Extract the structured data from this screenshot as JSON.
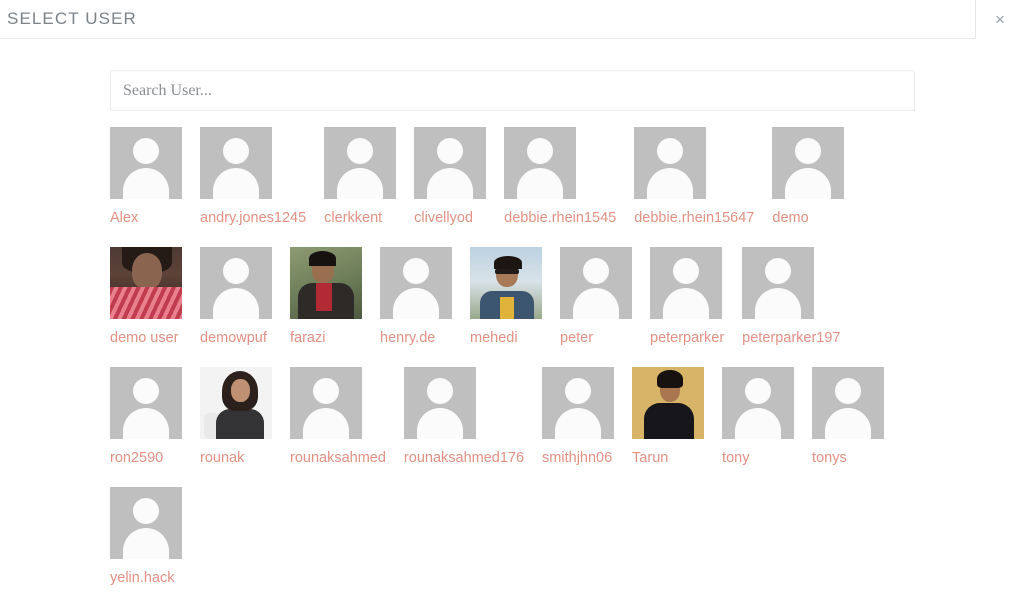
{
  "header": {
    "title": "SELECT USER",
    "close_icon": "close-icon",
    "close_glyph": "×"
  },
  "search": {
    "placeholder": "Search User...",
    "value": ""
  },
  "colors": {
    "label": "#e29184",
    "avatar_placeholder": "#bfbfbf",
    "title": "#7b8288",
    "border": "#e8e8e8"
  },
  "users": [
    {
      "label": "Alex",
      "avatar": "placeholder"
    },
    {
      "label": "andry.jones1245",
      "avatar": "placeholder"
    },
    {
      "label": "clerkkent",
      "avatar": "placeholder"
    },
    {
      "label": "clivellyod",
      "avatar": "placeholder"
    },
    {
      "label": "debbie.rhein1545",
      "avatar": "placeholder"
    },
    {
      "label": "debbie.rhein15647",
      "avatar": "placeholder"
    },
    {
      "label": "demo",
      "avatar": "placeholder"
    },
    {
      "label": "demo user",
      "avatar": "photo",
      "photo": "demouser"
    },
    {
      "label": "demowpuf",
      "avatar": "placeholder"
    },
    {
      "label": "farazi",
      "avatar": "photo",
      "photo": "farazi"
    },
    {
      "label": "henry.de",
      "avatar": "placeholder"
    },
    {
      "label": "mehedi",
      "avatar": "photo",
      "photo": "mehedi"
    },
    {
      "label": "peter",
      "avatar": "placeholder"
    },
    {
      "label": "peterparker",
      "avatar": "placeholder"
    },
    {
      "label": "peterparker197",
      "avatar": "placeholder"
    },
    {
      "label": "ron2590",
      "avatar": "placeholder"
    },
    {
      "label": "rounak",
      "avatar": "photo",
      "photo": "rounak"
    },
    {
      "label": "rounaksahmed",
      "avatar": "placeholder"
    },
    {
      "label": "rounaksahmed176",
      "avatar": "placeholder"
    },
    {
      "label": "smithjhn06",
      "avatar": "placeholder"
    },
    {
      "label": "Tarun",
      "avatar": "photo",
      "photo": "tarun"
    },
    {
      "label": "tony",
      "avatar": "placeholder"
    },
    {
      "label": "tonys",
      "avatar": "placeholder"
    },
    {
      "label": "yelin.hack",
      "avatar": "placeholder"
    }
  ]
}
